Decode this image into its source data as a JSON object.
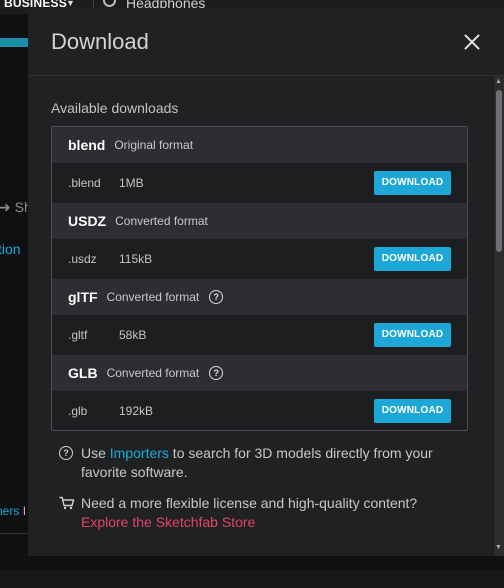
{
  "background": {
    "nav_business": "BUSINESS",
    "search_text": "Headphones",
    "share_text": "Sh",
    "option_text": "tion",
    "others_text": "ners",
    "others_sep": "I"
  },
  "modal": {
    "title": "Download",
    "available_label": "Available downloads",
    "formats": [
      {
        "name": "blend",
        "desc": "Original format",
        "has_help": false,
        "ext": ".blend",
        "size": "1MB",
        "button": "DOWNLOAD"
      },
      {
        "name": "USDZ",
        "desc": "Converted format",
        "has_help": false,
        "ext": ".usdz",
        "size": "115kB",
        "button": "DOWNLOAD"
      },
      {
        "name": "glTF",
        "desc": "Converted format",
        "has_help": true,
        "ext": ".gltf",
        "size": "58kB",
        "button": "DOWNLOAD"
      },
      {
        "name": "GLB",
        "desc": "Converted format",
        "has_help": true,
        "ext": ".glb",
        "size": "192kB",
        "button": "DOWNLOAD"
      }
    ],
    "info_importers": {
      "prefix": "Use ",
      "link": "Importers",
      "suffix": " to search for 3D models directly from your favorite software."
    },
    "info_store": {
      "text": "Need a more flexible license and high-quality content?",
      "link": "Explore the Sketchfab Store"
    }
  },
  "colors": {
    "accent": "#1ca7d6",
    "store_link": "#e6436a",
    "modal_bg": "#1f2123"
  },
  "icons": {
    "close": "close-icon",
    "help": "help-circle-icon",
    "cart": "cart-icon",
    "search": "search-icon"
  }
}
